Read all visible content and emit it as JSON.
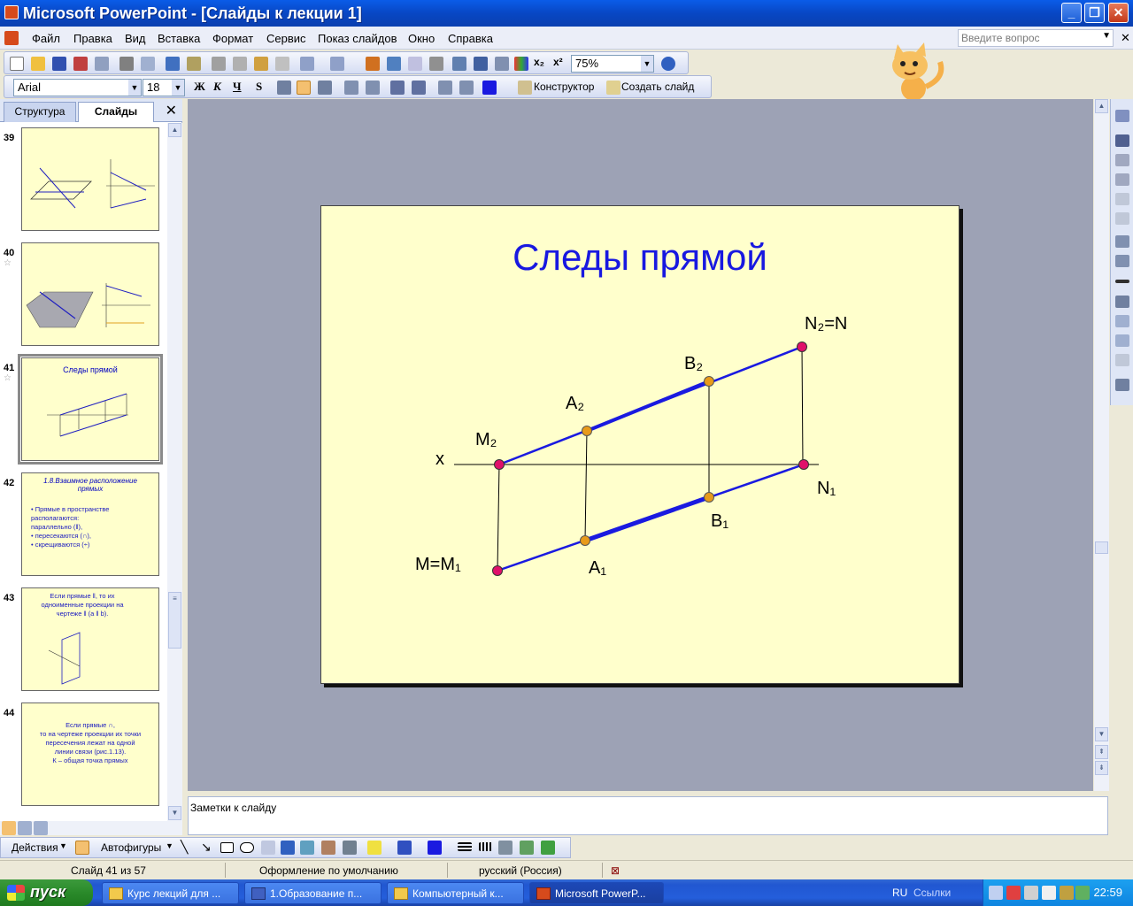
{
  "window": {
    "title": "Microsoft PowerPoint - [Слайды к лекции 1]",
    "minimize": "_",
    "maximize": "❐",
    "close": "✕"
  },
  "menu": {
    "items": [
      "Файл",
      "Правка",
      "Вид",
      "Вставка",
      "Формат",
      "Сервис",
      "Показ слайдов",
      "Окно",
      "Справка"
    ],
    "help_placeholder": "Введите вопрос"
  },
  "toolbar_standard": {
    "zoom": "75%"
  },
  "toolbar_format": {
    "font": "Arial",
    "size": "18",
    "bold": "Ж",
    "italic": "К",
    "underline": "Ч",
    "shadow": "S",
    "designer": "Конструктор",
    "new_slide": "Создать слайд"
  },
  "panel": {
    "tab_outline": "Структура",
    "tab_slides": "Слайды",
    "close": "✕"
  },
  "thumbnails": [
    {
      "num": "39"
    },
    {
      "num": "40"
    },
    {
      "num": "41",
      "title": "Следы прямой"
    },
    {
      "num": "42",
      "title": "1.8.Взаимное расположение прямых",
      "lines": [
        "• Прямые в пространстве",
        "  располагаются:",
        "  параллельно (ǁ),",
        "• пересекаются (∩),",
        "• скрещиваются (÷)"
      ]
    },
    {
      "num": "43",
      "lines": [
        "Если прямые ǁ, то их",
        "одноименные проекции на",
        "чертеже ǁ (a ǁ b)."
      ]
    },
    {
      "num": "44",
      "lines": [
        "Если прямые ∩,",
        "то на чертеже проекции их точки",
        "пересечения лежат на одной",
        "линии связи (рис.1.13).",
        "К – общая точка прямых"
      ]
    }
  ],
  "slide": {
    "title": "Следы прямой",
    "labels": {
      "n2": "N₂=N",
      "b2": "B₂",
      "a2": "A₂",
      "m2": "M₂",
      "x": "x",
      "n1": "N₁",
      "b1": "B₁",
      "a1": "A₁",
      "m": "M=M₁"
    },
    "colors": {
      "line": "#1a1ae0",
      "endpoint": "#e0106a",
      "midpoint": "#e89a1a"
    }
  },
  "notes": {
    "placeholder": "Заметки к слайду"
  },
  "drawing": {
    "actions": "Действия",
    "autoshapes": "Автофигуры"
  },
  "status": {
    "slide": "Слайд 41 из 57",
    "design": "Оформление по умолчанию",
    "language": "русский (Россия)"
  },
  "taskbar": {
    "start": "пуск",
    "tasks": [
      "Курс лекций для ...",
      "1.Образование п...",
      "Компьютерный к...",
      "Microsoft PowerP..."
    ],
    "lang": "RU",
    "links": "Ссылки",
    "clock": "22:59"
  }
}
